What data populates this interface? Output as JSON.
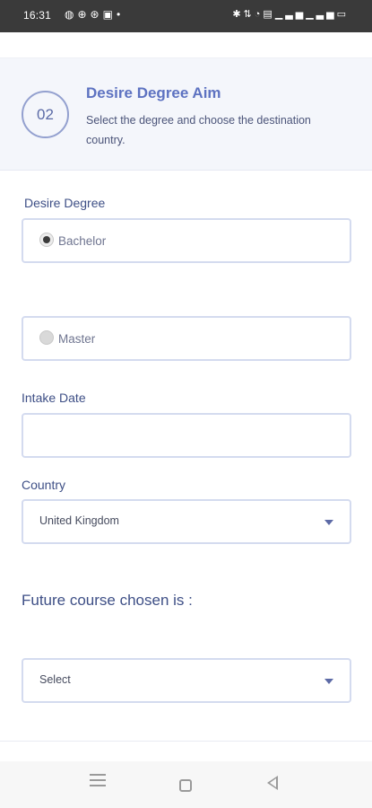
{
  "status_bar": {
    "time": "16:31",
    "left_icons": [
      "messenger-icon",
      "app-icon",
      "globe-icon",
      "gallery-icon",
      "dot-icon"
    ],
    "right_icons": [
      "bluetooth-icon",
      "data-icon",
      "wifi-icon",
      "volte-icon",
      "signal-icon",
      "signal-icon",
      "battery-icon"
    ]
  },
  "step": {
    "number": "02",
    "title": "Desire Degree Aim",
    "subtitle": "Select the degree and choose the destination country."
  },
  "form": {
    "degree_label": "Desire Degree",
    "degree_options": [
      {
        "label": "Bachelor",
        "selected": true
      },
      {
        "label": "Master",
        "selected": false
      }
    ],
    "intake_label": "Intake Date",
    "intake_value": "",
    "country_label": "Country",
    "country_value": "United Kingdom",
    "future_course_label": "Future course chosen is :",
    "future_course_value": "Select"
  },
  "colors": {
    "accent": "#5d72c1",
    "text": "#3e4f86",
    "border": "#d4dbef",
    "header_bg": "#f4f6fb"
  }
}
